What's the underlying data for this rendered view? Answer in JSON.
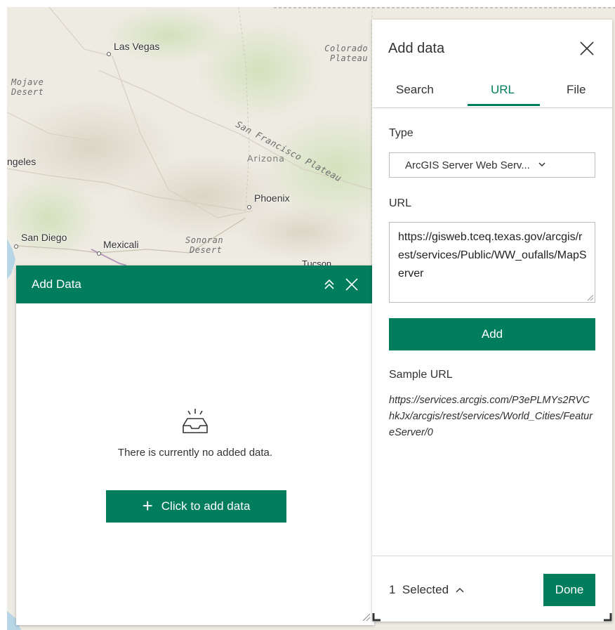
{
  "map": {
    "labels": {
      "las_vegas": "Las Vegas",
      "colorado_plateau_1": "Colorado",
      "colorado_plateau_2": "Plateau",
      "mojave_1": "Mojave",
      "mojave_2": "Desert",
      "san_francisco_plateau": "San Francisco Plateau",
      "los_angeles": "ngeles",
      "arizona": "Arizona",
      "phoenix": "Phoenix",
      "san_diego": "San Diego",
      "mexicali": "Mexicali",
      "sonoran_1": "Sonoran",
      "sonoran_2": "Desert",
      "tucson": "Tucson"
    }
  },
  "widget": {
    "title": "Add Data",
    "empty_message": "There is currently no added data.",
    "add_button_label": "Click to add data"
  },
  "side_panel": {
    "title": "Add data",
    "tabs": [
      {
        "label": "Search",
        "active": false
      },
      {
        "label": "URL",
        "active": true
      },
      {
        "label": "File",
        "active": false
      }
    ],
    "type_label": "Type",
    "type_value": "ArcGIS Server Web Serv...",
    "url_label": "URL",
    "url_value": "https://gisweb.tceq.texas.gov/arcgis/rest/services/Public/WW_oufalls/MapServer",
    "add_label": "Add",
    "sample_label": "Sample URL",
    "sample_url": "https://services.arcgis.com/P3ePLMYs2RVChkJx/arcgis/rest/services/World_Cities/FeatureServer/0",
    "selected_text": "1  Selected",
    "done_label": "Done"
  },
  "colors": {
    "accent": "#007d5c"
  }
}
